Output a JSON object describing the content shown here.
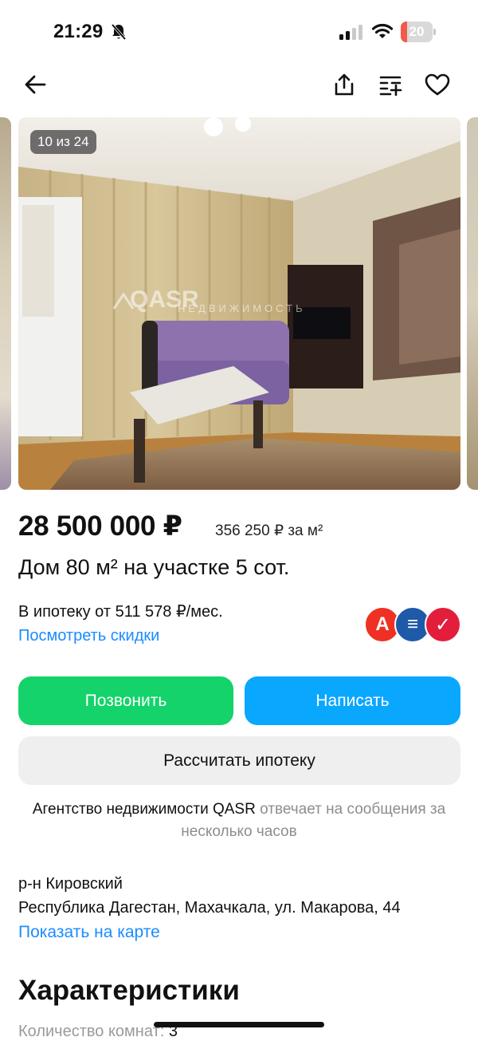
{
  "status_bar": {
    "time": "21:29",
    "battery_level": "20",
    "battery_fraction": 0.2,
    "battery_color": "#f05b4c",
    "icons": [
      "bell-off-icon",
      "cellular-signal-icon",
      "wifi-icon",
      "battery-icon"
    ]
  },
  "header": {
    "icons": [
      "back-arrow-icon",
      "share-icon",
      "compare-list-icon",
      "heart-icon"
    ]
  },
  "gallery": {
    "counter": "10 из 24",
    "watermark_brand": "QASR",
    "watermark_sub": "НЕДВИЖИМОСТЬ"
  },
  "listing": {
    "price": "28 500 000 ₽",
    "price_per_m2": "356 250 ₽ за м²",
    "title": "Дом 80 м² на участке 5 сот.",
    "mortgage_text": "В ипотеку от 511 578 ₽/мес.",
    "discounts_link": "Посмотреть скидки",
    "bank_logos": [
      {
        "name": "alfa-bank-logo-icon",
        "color": "#ef3124",
        "glyph": "А"
      },
      {
        "name": "gazprombank-logo-icon",
        "color": "#1e5aa8",
        "glyph": "≡"
      },
      {
        "name": "pochta-bank-logo-icon",
        "color": "#e31e3c",
        "glyph": "✓"
      }
    ]
  },
  "actions": {
    "call_label": "Позвонить",
    "write_label": "Написать",
    "calc_label": "Рассчитать ипотеку",
    "colors": {
      "call": "#13d36a",
      "write": "#0aa7ff",
      "calc": "#efefef"
    }
  },
  "agency": {
    "name": "Агентство недвижимости QASR",
    "response_text": " отвечает на сообщения за несколько часов"
  },
  "location": {
    "district": "р-н Кировский",
    "address": "Республика Дагестан, Махачкала, ул. Макарова, 44",
    "map_link": "Показать на карте"
  },
  "characteristics": {
    "title": "Характеристики",
    "rows": [
      {
        "label": "Количество комнат: ",
        "value": "3"
      }
    ]
  },
  "accent_colors": {
    "link": "#1a8cff",
    "text": "#111111",
    "secondary_text": "#8d8d8d"
  }
}
